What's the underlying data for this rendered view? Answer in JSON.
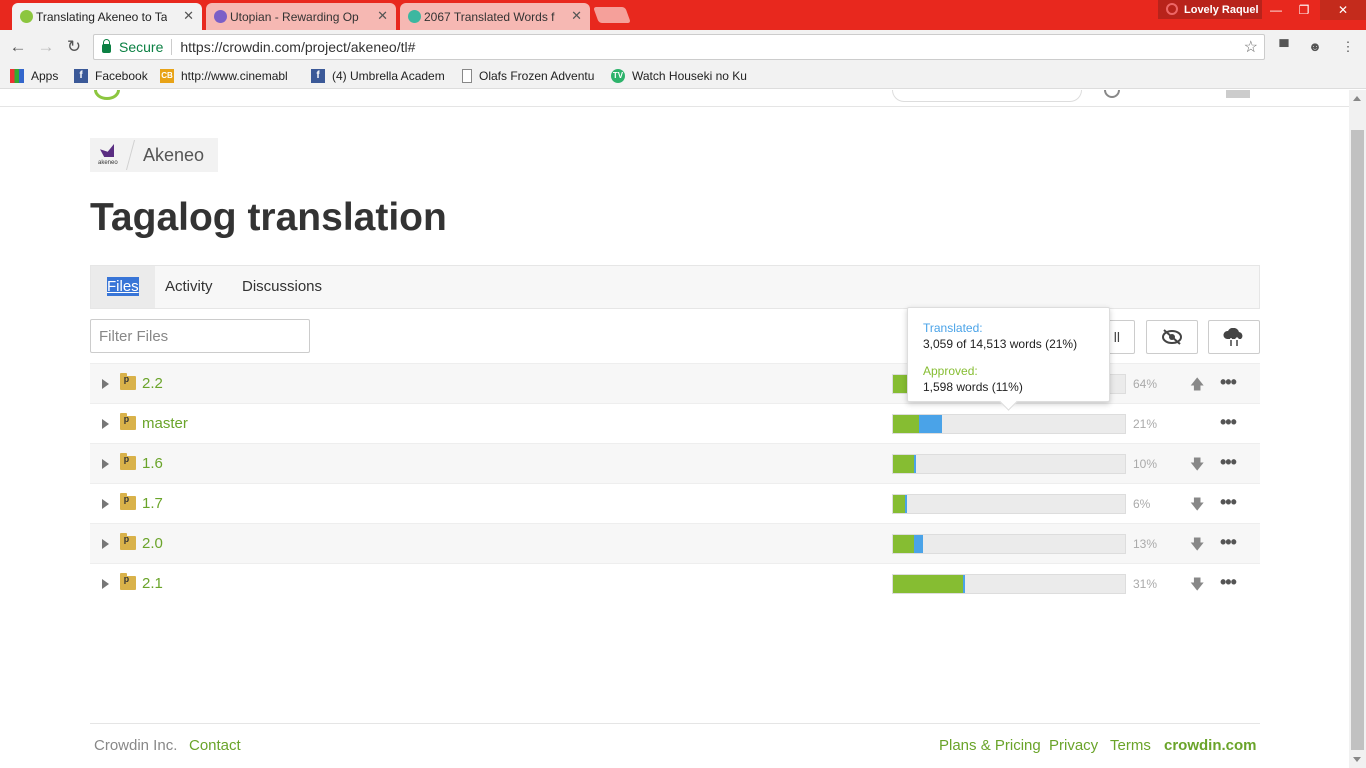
{
  "browser": {
    "tabs": [
      {
        "title": "Translating Akeneo to Ta",
        "active": true
      },
      {
        "title": "Utopian - Rewarding Op",
        "active": false
      },
      {
        "title": "2067 Translated Words f",
        "active": false
      }
    ],
    "profile_name": "Lovely Raquel",
    "secure_label": "Secure",
    "url": "https://crowdin.com/project/akeneo/tl#",
    "bookmarks": [
      {
        "label": "Apps",
        "icon": "apps-icon"
      },
      {
        "label": "Facebook",
        "icon": "facebook-icon"
      },
      {
        "label": "http://www.cinemabl",
        "icon": "cb-icon"
      },
      {
        "label": "(4) Umbrella Academ",
        "icon": "facebook-icon"
      },
      {
        "label": "Olafs Frozen Adventu",
        "icon": "page-icon"
      },
      {
        "label": "Watch Houseki no Ku",
        "icon": "tv-icon"
      }
    ]
  },
  "project": {
    "name": "Akeneo",
    "logo_text": "akeneo"
  },
  "page": {
    "title": "Tagalog translation",
    "tabs": [
      "Files",
      "Activity",
      "Discussions"
    ],
    "filter_placeholder": "Filter Files",
    "hidden_button_text": "ll"
  },
  "files": [
    {
      "name": "2.2",
      "approved": 0.07,
      "translated": 0.07,
      "percent": "64%",
      "action": "upload-icon"
    },
    {
      "name": "master",
      "approved": 0.11,
      "translated": 0.21,
      "percent": "21%",
      "action": ""
    },
    {
      "name": "1.6",
      "approved": 0.09,
      "translated": 0.1,
      "percent": "10%",
      "action": "download-icon"
    },
    {
      "name": "1.7",
      "approved": 0.05,
      "translated": 0.06,
      "percent": "6%",
      "action": "download-icon"
    },
    {
      "name": "2.0",
      "approved": 0.09,
      "translated": 0.13,
      "percent": "13%",
      "action": "download-icon"
    },
    {
      "name": "2.1",
      "approved": 0.3,
      "translated": 0.31,
      "percent": "31%",
      "action": "download-icon"
    }
  ],
  "tooltip": {
    "translated_label": "Translated:",
    "translated_value": "3,059 of 14,513 words (21%)",
    "approved_label": "Approved:",
    "approved_value": "1,598 words (11%)"
  },
  "footer": {
    "company": "Crowdin Inc.",
    "contact": "Contact",
    "plans": "Plans & Pricing",
    "privacy": "Privacy",
    "terms": "Terms",
    "brand": "crowdin.com"
  },
  "colors": {
    "approved": "#86bd32",
    "translated": "#4aa3e8",
    "link": "#6aa42a",
    "chrome_red": "#e8281e"
  }
}
